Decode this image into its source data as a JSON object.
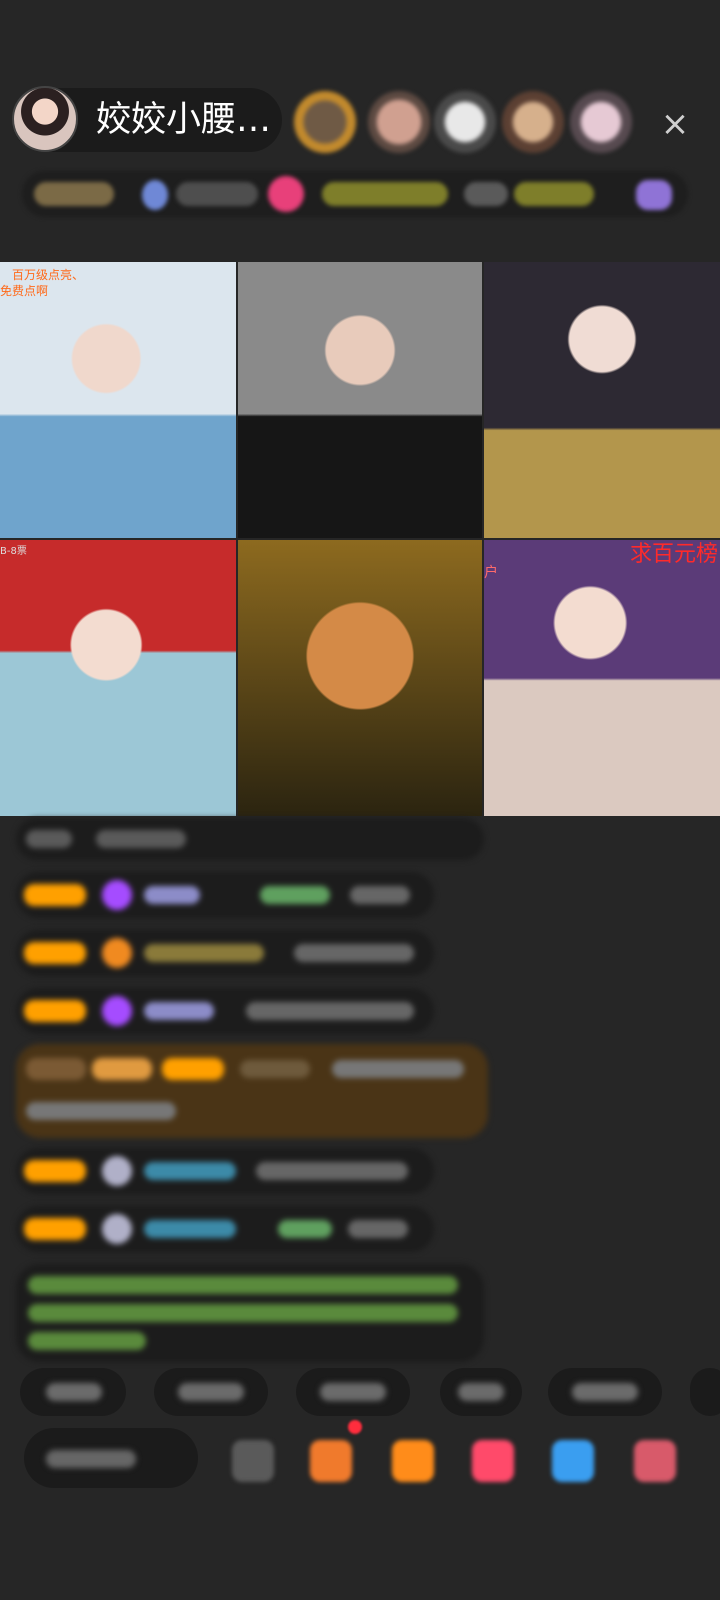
{
  "header": {
    "anchor_name": "姣姣小腰…",
    "close_icon": "×"
  },
  "grid": {
    "tile1_tag_line1": "百万级点亮、",
    "tile1_tag_line2": "免费点啊",
    "tile4_tag": "B-8票",
    "tile6_tag": "户",
    "tile6_banner": "求百元榜"
  },
  "icons": {
    "avatar": "streamer-avatar",
    "viewers": [
      "viewer-avatar",
      "viewer-avatar",
      "viewer-avatar",
      "viewer-avatar",
      "viewer-avatar"
    ],
    "close": "close-icon"
  },
  "colors": {
    "background": "#262626",
    "accent_orange": "#ffa000",
    "purple_gem": "#a54cff",
    "chat_green": "#7cc14b"
  }
}
